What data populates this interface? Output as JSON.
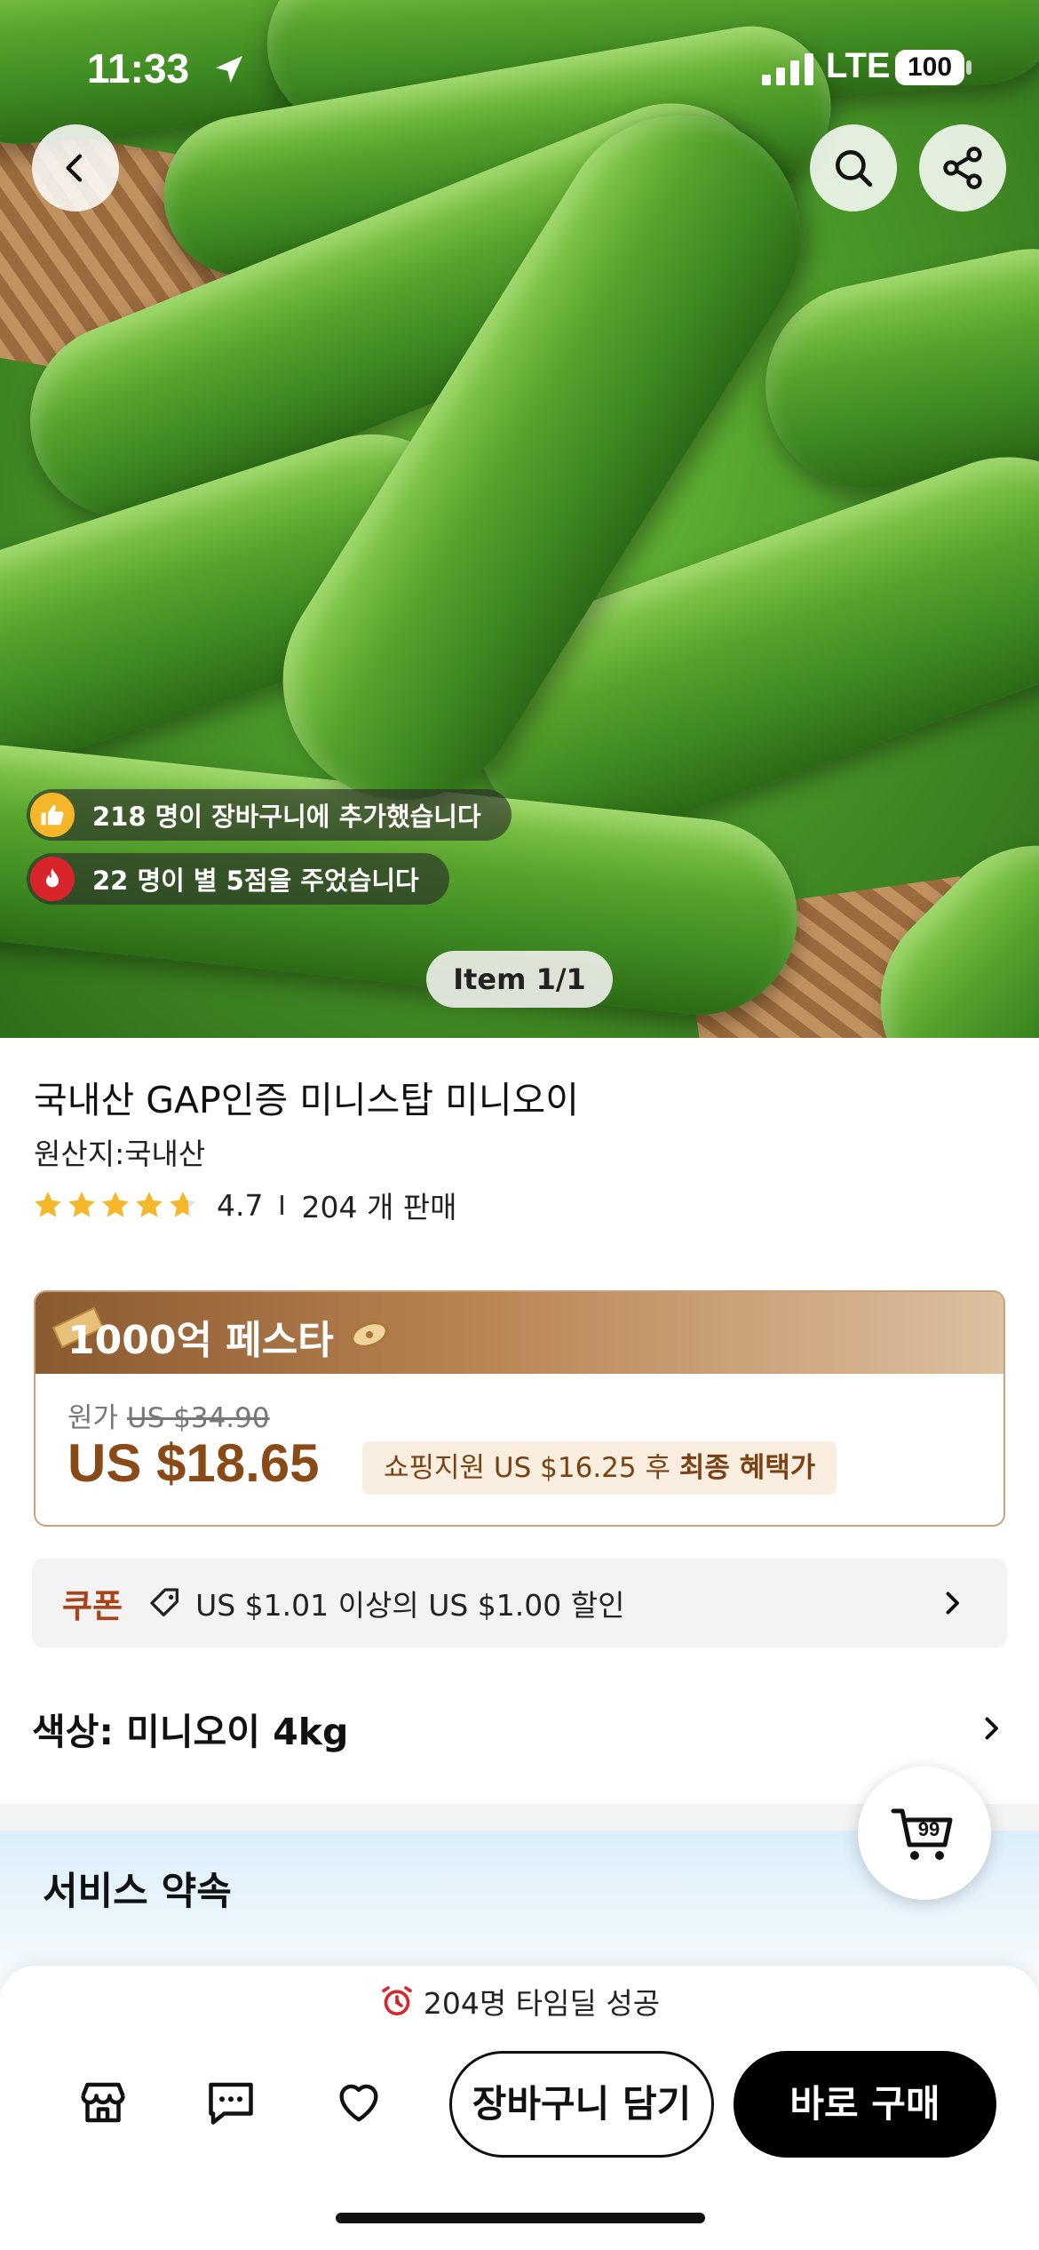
{
  "status_bar": {
    "time": "11:33",
    "network": "LTE",
    "battery": "100"
  },
  "hero": {
    "social_proof": [
      {
        "icon": "thumbs-up-icon",
        "text": "218 명이 장바구니에 추가했습니다"
      },
      {
        "icon": "fire-icon",
        "text": "22 명이 별 5점을 주었습니다"
      }
    ],
    "item_counter": "Item 1/1"
  },
  "product": {
    "title": "국내산 GAP인증 미니스탑 미니오이",
    "origin": "원산지:국내산",
    "rating": "4.7",
    "rating_stars": 4.7,
    "sold": "204 개 판매"
  },
  "festa": {
    "title": "1000억 페스타",
    "original_label": "원가",
    "original_price": "US $34.90",
    "price": "US $18.65",
    "subsidy_prefix": "쇼핑지원 US $16.25 후 ",
    "subsidy_bold": "최종 혜택가"
  },
  "coupon": {
    "label": "쿠폰",
    "text": "US $1.01 이상의 US $1.00 할인"
  },
  "color_option": {
    "label": "색상: 미니오이 4kg"
  },
  "service": {
    "title": "서비스 약속"
  },
  "cart_fab": {
    "count": "99"
  },
  "bottom_bar": {
    "timedeal": "204명 타임딜 성공",
    "add_to_cart": "장바구니 담기",
    "buy_now": "바로 구매"
  },
  "colors": {
    "accent_brown": "#8a4a18",
    "coupon_red": "#a8431a",
    "buy_button": "#000000"
  }
}
